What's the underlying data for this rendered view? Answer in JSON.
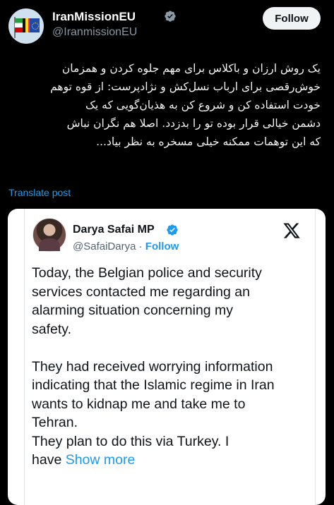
{
  "post": {
    "author_name": "IranMissionEU",
    "author_handle": "@IranmissionEU",
    "follow_label": "Follow",
    "text": "یک روش ارزان و باکلاس برای مهم جلوه کردن و همزمان\nخوش‌رقصی برای ارباب نسل‌کش و نژادپرست: از قوه توهم\nخودت استفاده کن و شروع کن به هذیان‌گویی که یک\nدشمن خیالی قرار بوده تو را بدزدد. اصلا هم نگران نباش\nکه این توهمات ممکنه خیلی مسخره به نظر بیاد...",
    "translate_label": "Translate post"
  },
  "quote": {
    "author_name": "Darya Safai MP",
    "author_handle": "@SafaiDarya",
    "separator": " · ",
    "follow_label": "Follow",
    "body": "Today, the Belgian police and security\nservices contacted me regarding an\nalarming situation concerning my\nsafety.\n\nThey had received worrying information\nindicating that the Islamic regime in Iran\nwants to kidnap me and take me to\nTehran.\nThey plan to do this via Turkey. I\nhave ",
    "show_more_label": "Show more"
  },
  "icons": {
    "verified": "verified-badge-icon",
    "platform": "x-logo-icon"
  },
  "colors": {
    "background": "#000000",
    "link": "#1d9bf0",
    "verified": "#1d9bf0",
    "card_background": "#ffffff"
  }
}
